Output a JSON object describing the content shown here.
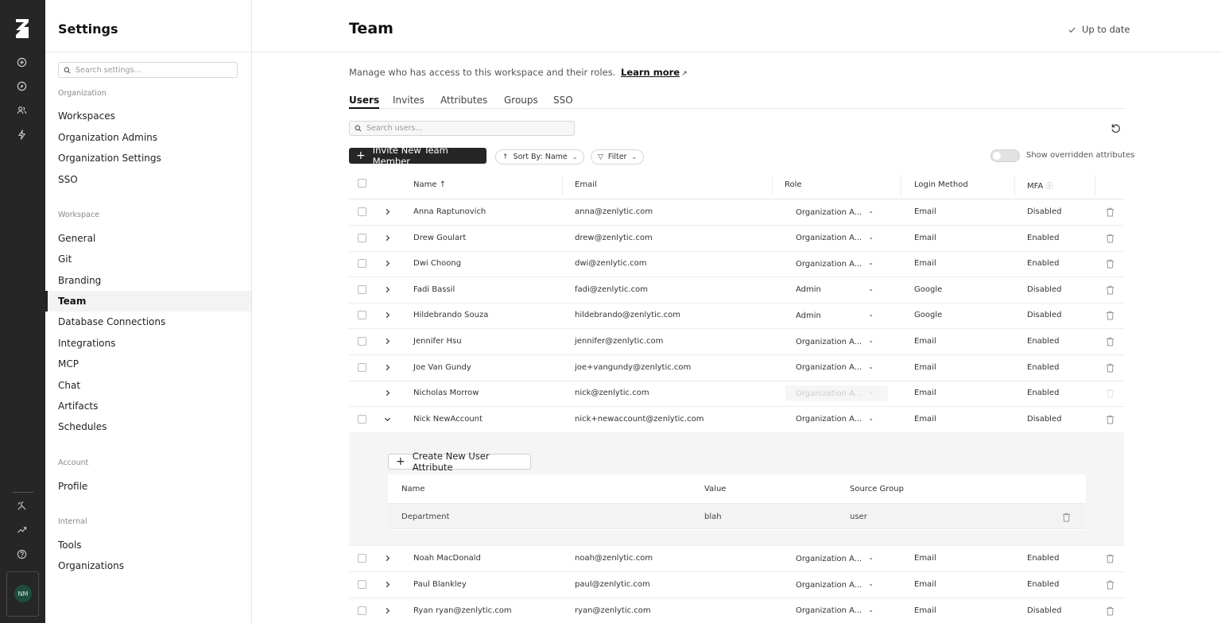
{
  "app": {
    "avatar_initials": "NM"
  },
  "sidebar": {
    "title": "Settings",
    "search_placeholder": "Search settings...",
    "sections": {
      "organization": "Organization",
      "workspace": "Workspace",
      "account": "Account",
      "internal": "Internal"
    },
    "items": {
      "workspaces": "Workspaces",
      "organization_admins": "Organization Admins",
      "organization_settings": "Organization Settings",
      "sso": "SSO",
      "general": "General",
      "git": "Git",
      "branding": "Branding",
      "team": "Team",
      "database_connections": "Database Connections",
      "integrations": "Integrations",
      "mcp": "MCP",
      "chat": "Chat",
      "artifacts": "Artifacts",
      "schedules": "Schedules",
      "profile": "Profile",
      "tools": "Tools",
      "organizations": "Organizations"
    }
  },
  "header": {
    "title": "Team",
    "status": "Up to date"
  },
  "main": {
    "description": "Manage who has access to this workspace and their roles.",
    "learn_more": "Learn more",
    "tabs": [
      "Users",
      "Invites",
      "Attributes",
      "Groups",
      "SSO"
    ],
    "active_tab": "Users",
    "search_placeholder": "Search users...",
    "invite_button": "Invite New Team Member",
    "sort_label": "Sort By: Name",
    "filter_label": "Filter",
    "toggle_label": "Show overridden attributes",
    "columns": {
      "name": "Name",
      "email": "Email",
      "role": "Role",
      "login_method": "Login Method",
      "mfa": "MFA"
    },
    "users": [
      {
        "name": "Anna Raptunovich",
        "email": "anna@zenlytic.com",
        "role": "Organization A...",
        "login": "Email",
        "mfa": "Disabled"
      },
      {
        "name": "Drew Goulart",
        "email": "drew@zenlytic.com",
        "role": "Organization A...",
        "login": "Email",
        "mfa": "Enabled"
      },
      {
        "name": "Dwi Choong",
        "email": "dwi@zenlytic.com",
        "role": "Organization A...",
        "login": "Email",
        "mfa": "Enabled"
      },
      {
        "name": "Fadi Bassil",
        "email": "fadi@zenlytic.com",
        "role": "Admin",
        "login": "Google",
        "mfa": "Disabled"
      },
      {
        "name": "Hildebrando Souza",
        "email": "hildebrando@zenlytic.com",
        "role": "Admin",
        "login": "Google",
        "mfa": "Disabled"
      },
      {
        "name": "Jennifer Hsu",
        "email": "jennifer@zenlytic.com",
        "role": "Organization A...",
        "login": "Email",
        "mfa": "Enabled"
      },
      {
        "name": "Joe Van Gundy",
        "email": "joe+vangundy@zenlytic.com",
        "role": "Organization A...",
        "login": "Email",
        "mfa": "Enabled"
      },
      {
        "name": "Nicholas Morrow",
        "email": "nick@zenlytic.com",
        "role": "Organization A...",
        "login": "Email",
        "mfa": "Enabled"
      },
      {
        "name": "Nick NewAccount",
        "email": "nick+newaccount@zenlytic.com",
        "role": "Organization A...",
        "login": "Email",
        "mfa": "Disabled"
      },
      {
        "name": "Noah MacDonald",
        "email": "noah@zenlytic.com",
        "role": "Organization A...",
        "login": "Email",
        "mfa": "Enabled"
      },
      {
        "name": "Paul Blankley",
        "email": "paul@zenlytic.com",
        "role": "Organization A...",
        "login": "Email",
        "mfa": "Enabled"
      },
      {
        "name": "Ryan ryan@zenlytic.com",
        "email": "ryan@zenlytic.com",
        "role": "Organization A...",
        "login": "Email",
        "mfa": "Disabled"
      }
    ],
    "expanded": {
      "create_button": "Create New User Attribute",
      "columns": {
        "name": "Name",
        "value": "Value",
        "source_group": "Source Group"
      },
      "rows": [
        {
          "name": "Department",
          "value": "blah",
          "source_group": "user"
        }
      ]
    }
  }
}
